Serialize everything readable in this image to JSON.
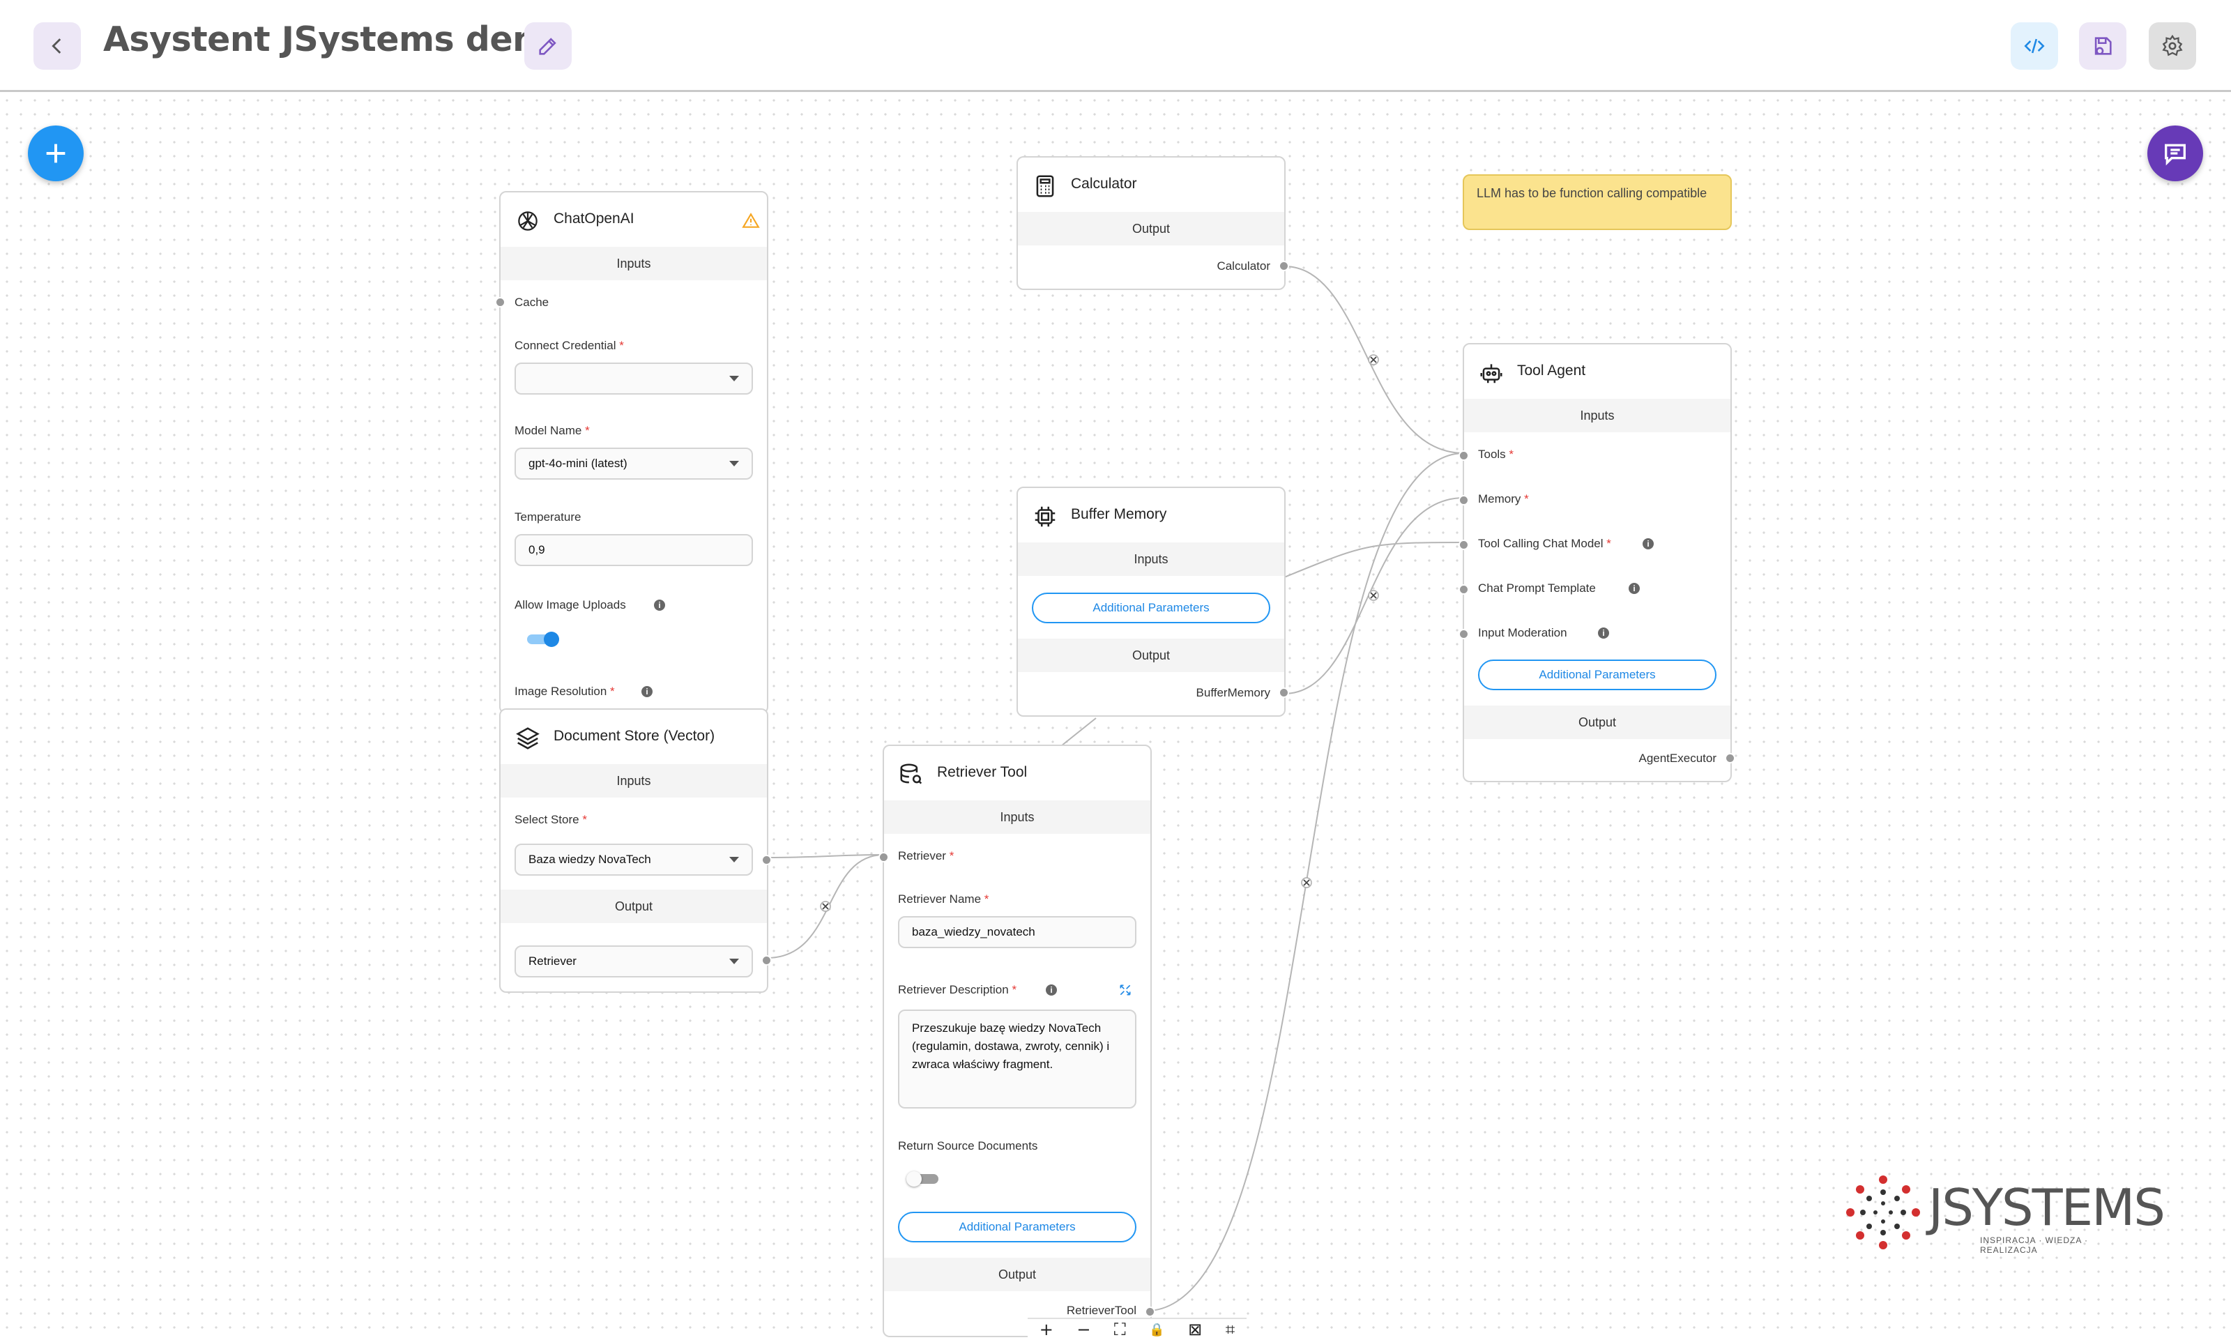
{
  "header": {
    "title": "Asystent JSystems demo",
    "colors": {
      "accent": "#7e57c2",
      "code_btn_bg": "#e3f2fd",
      "save_btn_bg": "#ede7f6",
      "settings_btn_bg": "#e0e0e0"
    }
  },
  "sticky_note": {
    "text": "LLM has to be function calling compatible"
  },
  "nodes": {
    "chatopenai": {
      "title": "ChatOpenAI",
      "inputs_label": "Inputs",
      "cache_label": "Cache",
      "credential_label": "Connect Credential",
      "credential_value": "",
      "model_label": "Model Name",
      "model_value": "gpt-4o-mini (latest)",
      "temperature_label": "Temperature",
      "temperature_value": "0,9",
      "image_uploads_label": "Allow Image Uploads",
      "image_uploads_on": true,
      "image_resolution_label": "Image Resolution"
    },
    "document_store": {
      "title": "Document Store (Vector)",
      "inputs_label": "Inputs",
      "select_store_label": "Select Store",
      "select_store_value": "Baza wiedzy NovaTech",
      "output_label": "Output",
      "output_value": "Retriever"
    },
    "calculator": {
      "title": "Calculator",
      "output_label": "Output",
      "output_value": "Calculator"
    },
    "buffer_memory": {
      "title": "Buffer Memory",
      "inputs_label": "Inputs",
      "additional_params": "Additional Parameters",
      "output_label": "Output",
      "output_value": "BufferMemory"
    },
    "retriever_tool": {
      "title": "Retriever Tool",
      "inputs_label": "Inputs",
      "retriever_label": "Retriever",
      "name_label": "Retriever Name",
      "name_value": "baza_wiedzy_novatech",
      "description_label": "Retriever Description",
      "description_value": "Przeszukuje bazę wiedzy NovaTech (regulamin, dostawa, zwroty, cennik) i zwraca właściwy fragment.",
      "return_source_label": "Return Source Documents",
      "return_source_on": false,
      "additional_params": "Additional Parameters",
      "output_label": "Output",
      "output_value": "RetrieverTool"
    },
    "tool_agent": {
      "title": "Tool Agent",
      "inputs_label": "Inputs",
      "tools_label": "Tools",
      "memory_label": "Memory",
      "chat_model_label": "Tool Calling Chat Model",
      "prompt_template_label": "Chat Prompt Template",
      "moderation_label": "Input Moderation",
      "additional_params": "Additional Parameters",
      "output_label": "Output",
      "output_value": "AgentExecutor"
    }
  },
  "toolbar": {
    "zoom_in": "+",
    "zoom_out": "−",
    "fit_view": "⛶",
    "lock": "🔒",
    "toggle_minimap": "⊠",
    "snap": "⌗"
  },
  "logo": {
    "name": "JSYSTEMS",
    "tagline": "INSPIRACJA · WIEDZA · REALIZACJA"
  }
}
